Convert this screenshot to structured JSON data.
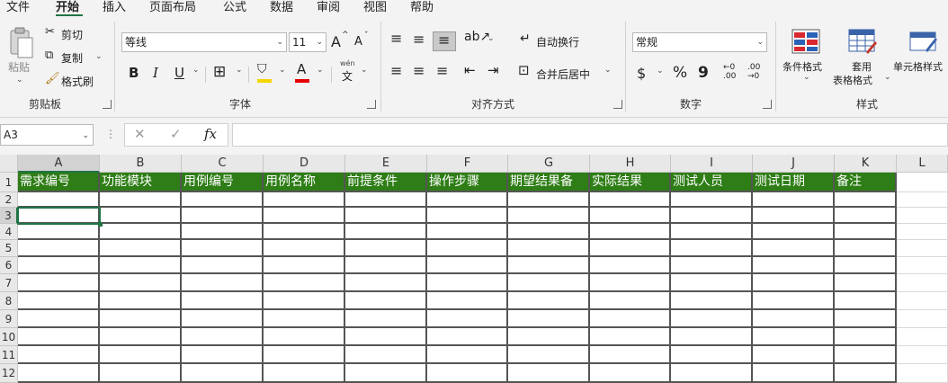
{
  "menu": [
    "文件",
    "开始",
    "插入",
    "页面布局",
    "公式",
    "数据",
    "审阅",
    "视图",
    "帮助"
  ],
  "ribbon": {
    "clipboard": {
      "paste": "粘贴",
      "cut": "剪切",
      "copy": "复制",
      "format_painter": "格式刷",
      "label": "剪贴板"
    },
    "font": {
      "family": "等线",
      "size": "11",
      "grow": "A",
      "shrink": "A",
      "bold": "B",
      "italic": "I",
      "underline": "U",
      "wen": "wén",
      "wen_char": "文",
      "label": "字体"
    },
    "alignment": {
      "wrap_text": "自动换行",
      "merge_center": "合并后居中",
      "label": "对齐方式"
    },
    "number": {
      "format": "常规",
      "currency": "$",
      "percent": "%",
      "comma": "9",
      "inc_decimal_top": "←0",
      "inc_decimal_bottom": ".00",
      "dec_decimal_top": ".00",
      "dec_decimal_bottom": "→0",
      "label": "数字"
    },
    "styles": {
      "conditional": "条件格式",
      "table_line1": "套用",
      "table_line2": "表格格式",
      "cell_styles": "单元格样式",
      "label": "样式"
    }
  },
  "formula_bar": {
    "name_box": "A3",
    "cancel": "✕",
    "enter": "✓",
    "fx": "fx",
    "value": ""
  },
  "sheet": {
    "columns": [
      "A",
      "B",
      "C",
      "D",
      "E",
      "F",
      "G",
      "H",
      "I",
      "J",
      "K",
      "L"
    ],
    "rows": [
      "1",
      "2",
      "3",
      "4",
      "5",
      "6",
      "7",
      "8",
      "9",
      "10",
      "11",
      "12"
    ],
    "header_row": [
      "需求编号",
      "功能模块",
      "用例编号",
      "用例名称",
      "前提条件",
      "操作步骤",
      "期望结果备",
      "实际结果",
      "测试人员",
      "测试日期",
      "备注"
    ],
    "active_cell": "A3",
    "colors": {
      "header_fill": "#2e7d16",
      "header_text": "#ffffff",
      "accent": "#217346"
    }
  }
}
